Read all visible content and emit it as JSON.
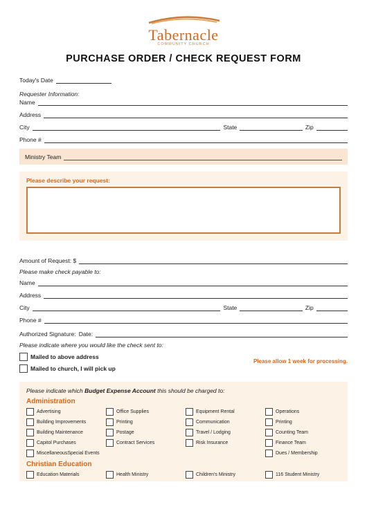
{
  "logo": {
    "text": "Tabernacle",
    "sub": "COMMUNITY CHURCH"
  },
  "title": "PURCHASE ORDER / CHECK REQUEST FORM",
  "fields": {
    "date_label": "Today's Date",
    "requester_header": "Requester Information:",
    "name": "Name",
    "address": "Address",
    "city": "City",
    "state": "State",
    "zip": "Zip",
    "phone": "Phone #",
    "ministry_team": "Ministry Team",
    "describe": "Please describe your request:",
    "amount": "Amount of Request: $",
    "payable": "Please make check payable to:",
    "signature": "Authorized Signature:",
    "sig_date": "Date:",
    "sent_to": "Please indicate where you would like the check sent to:",
    "mailed_above": "Mailed to above address",
    "mailed_pickup": "Mailed to church, I will pick up",
    "processing_note": "Please allow 1 week for processing."
  },
  "budget": {
    "head_pre": "Please indicate which ",
    "head_bold": "Budget Expense Account",
    "head_post": " this should be charged to:",
    "cat1": "Administration",
    "cat1_items": [
      [
        "Advertising",
        "Office Supplies",
        "Equipment Rental",
        "Operations"
      ],
      [
        "Building Improvements",
        "Printing",
        "Communication",
        "Printing"
      ],
      [
        "Building Maintenance",
        "Postage",
        "Travel / Lodging",
        "Counting Team"
      ],
      [
        "Capitol Purchases",
        "Contract Services",
        "Risk Insurance",
        "Finance Team"
      ],
      [
        "MiscellaneousSpecial Events",
        "",
        "",
        "Dues / Membership"
      ]
    ],
    "cat2": "Christian Education",
    "cat2_items": [
      [
        "Education Materials",
        "Health Ministry",
        "Children's Ministry",
        "116 Student Ministry"
      ]
    ]
  },
  "colors": {
    "accent": "#d2691e",
    "tint": "#fdf2e6",
    "band": "#f9e5d1"
  }
}
